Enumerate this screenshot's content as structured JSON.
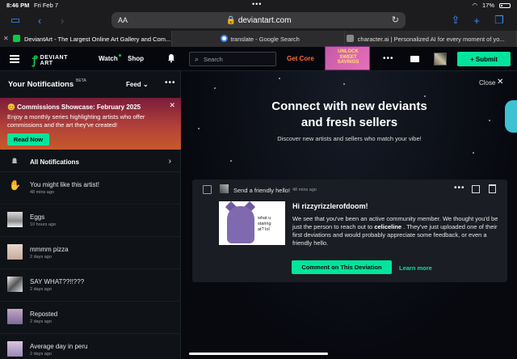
{
  "status": {
    "time": "8:46 PM",
    "date": "Fri Feb 7",
    "battery": "17%"
  },
  "browser": {
    "aa": "AA",
    "url": "deviantart.com",
    "tabs": [
      {
        "label": "DeviantArt - The Largest Online Art Gallery and Com...",
        "favicon_color": "#05cc47",
        "active": true
      },
      {
        "label": "translate - Google Search",
        "favicon_color": "#4285f4",
        "active": false
      },
      {
        "label": "character.ai | Personalized AI for every moment of yo...",
        "favicon_color": "#888888",
        "active": false
      }
    ]
  },
  "header": {
    "logo_line1": "DEVIANT",
    "logo_line2": "ART",
    "watch": "Watch",
    "shop": "Shop",
    "search_placeholder": "Search",
    "get_core": "Get Core",
    "promo": "UNLOCK SWEET SAVINGS",
    "submit": "+ Submit"
  },
  "sidebar": {
    "title": "Your Notifications",
    "beta": "BETA",
    "feed": "Feed",
    "banner": {
      "title": "😊 Commissions Showcase: February 2025",
      "text": "Enjoy a monthly series highlighting artists who offer commissions and the art they've created!",
      "button": "Read Now"
    },
    "all_notifications": "All Notifications",
    "items": [
      {
        "title": "You might like this artist!",
        "time": "48 mins ago"
      },
      {
        "title": "Eggs",
        "time": "10 hours ago"
      },
      {
        "title": "mmmm pizza",
        "time": "2 days ago"
      },
      {
        "title": "SAY WHAT??!!???",
        "time": "2 days ago"
      },
      {
        "title": "Reposted",
        "time": "2 days ago"
      },
      {
        "title": "Average day in peru",
        "time": "2 days ago"
      }
    ]
  },
  "main": {
    "close": "Close",
    "headline_1": "Connect with new deviants",
    "headline_2": "and fresh sellers",
    "subline": "Discover new artists and sellers who match your vibe!",
    "card": {
      "title": "Send a friendly hello!",
      "time": "48 mins ago",
      "greeting": "Hi rizzyrizzlerofdoom!",
      "msg_1": "We see that you've been an active community member. We thought you'd be just the person to reach out to ",
      "msg_user": "celiceline",
      "msg_2": " . They've just uploaded one of their first deviations and would probably appreciate some feedback, or even a friendly hello.",
      "deviation_text_1": "what u staring",
      "deviation_text_2": "at? lol",
      "comment_button": "Comment on This Deviation",
      "learn_more": "Learn more"
    }
  },
  "colors": {
    "accent": "#00e59b",
    "brand": "#05cc47",
    "orange": "#ff6b33"
  }
}
